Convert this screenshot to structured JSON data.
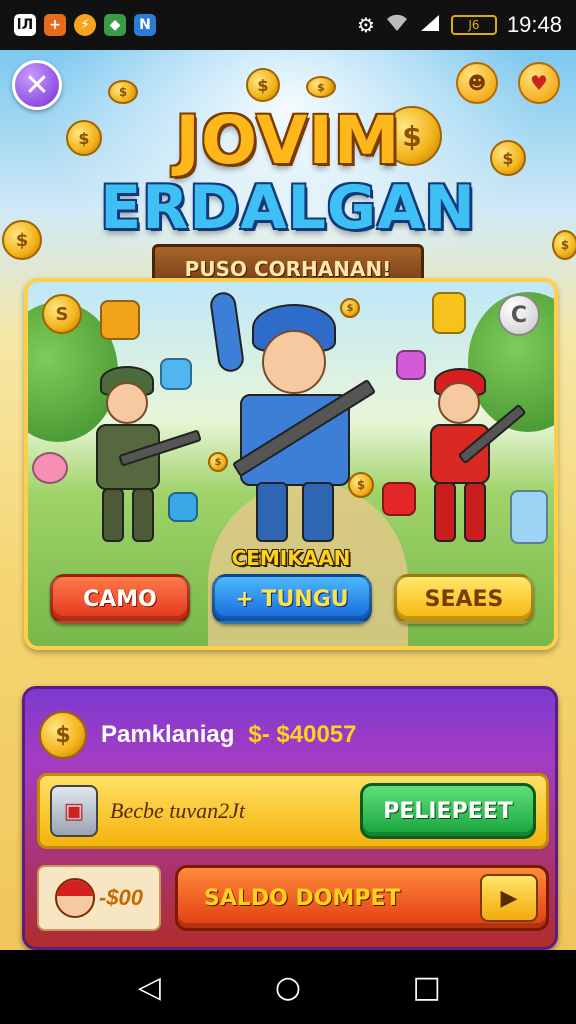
{
  "status_bar": {
    "app_icons": [
      {
        "icon": "app-icon-lw",
        "glyph": "lЛ",
        "color": "#ffffff"
      },
      {
        "icon": "plus-icon",
        "glyph": "+",
        "color": "#e86b1a"
      },
      {
        "icon": "lightning-icon",
        "glyph": "⚡",
        "color": "#f4a51c"
      },
      {
        "icon": "cube-icon",
        "glyph": "◆",
        "color": "#3a9b45"
      },
      {
        "icon": "app-icon-n",
        "glyph": "N",
        "color": "#2a7bd4"
      }
    ],
    "battery_text": "J6",
    "time": "19:48"
  },
  "game": {
    "close_glyph": "✕",
    "logo_line1": "JOVIM",
    "logo_line2": "ERDALGAN",
    "ribbon_text": "PUSO CORHANAN!",
    "scene": {
      "coin_badge": "S",
      "refresh_glyph": "C",
      "caption": "CEMIKAAN",
      "buttons": [
        {
          "label": "CAMO",
          "style": "red"
        },
        {
          "label": "+ TUNGU",
          "style": "blue"
        },
        {
          "label": "SEAES",
          "style": "yellow"
        }
      ]
    }
  },
  "wallet": {
    "coin_glyph": "$",
    "title": "Pamklaniag",
    "amount": "$- $40057",
    "row1_text": "Becbe tuvan2Jt",
    "row1_button": "PELIEPEET",
    "mini_value": "-$00",
    "saldo_label": "SALDO DOMPET",
    "play_glyph": "▶"
  },
  "nav": {
    "back_glyph": "◁",
    "home_glyph": "○",
    "recent_glyph": "□"
  },
  "colors": {
    "accent_purple": "#7d3ad0",
    "gold": "#ffd21c",
    "green_button": "#17a23c"
  }
}
